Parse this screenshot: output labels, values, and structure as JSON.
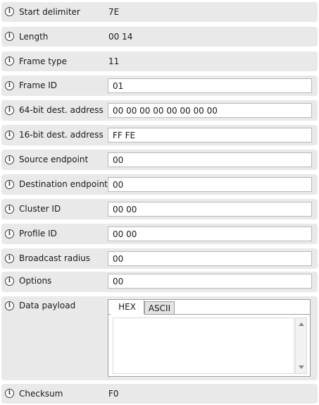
{
  "fields": {
    "start_delimiter": {
      "label": "Start delimiter",
      "value": "7E"
    },
    "length": {
      "label": "Length",
      "value": "00 14"
    },
    "frame_type": {
      "label": "Frame type",
      "value": "11"
    },
    "frame_id": {
      "label": "Frame ID",
      "value": "01"
    },
    "dest_address_64": {
      "label": "64-bit dest. address",
      "value": "00 00 00 00 00 00 00 00"
    },
    "dest_address_16": {
      "label": "16-bit dest. address",
      "value": "FF FE"
    },
    "source_endpoint": {
      "label": "Source endpoint",
      "value": "00"
    },
    "destination_endpoint": {
      "label": "Destination endpoint",
      "value": "00"
    },
    "cluster_id": {
      "label": "Cluster ID",
      "value": "00 00"
    },
    "profile_id": {
      "label": "Profile ID",
      "value": "00 00"
    },
    "broadcast_radius": {
      "label": "Broadcast radius",
      "value": "00"
    },
    "options": {
      "label": "Options",
      "value": "00"
    },
    "data_payload": {
      "label": "Data payload",
      "tabs": [
        "HEX",
        "ASCII"
      ],
      "selected_tab": "HEX",
      "value": ""
    },
    "checksum": {
      "label": "Checksum",
      "value": "F0"
    }
  },
  "icon": {
    "name": "info-icon",
    "glyph": "i"
  },
  "colors": {
    "row_background": "#e9e9e9",
    "field_border": "#b9b9b9"
  }
}
